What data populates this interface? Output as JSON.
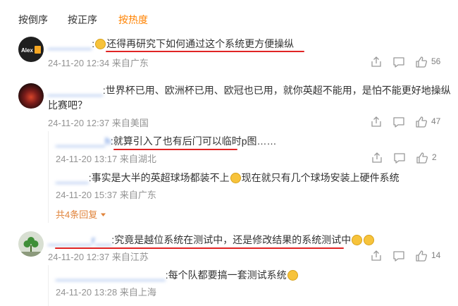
{
  "sort": {
    "reverse": "按倒序",
    "forward": "按正序",
    "hot": "按热度"
  },
  "colors": {
    "accent": "#ff8200",
    "username": "#2e6ad5",
    "underline": "#e02424",
    "meta": "#939393"
  },
  "comments": [
    {
      "avatar_text": "Alex",
      "username": "________",
      "text": "还得再研究下如何通过这个系统更方便操纵",
      "time": "24-11-20 12:34",
      "location": "来自广东",
      "likes": "56"
    },
    {
      "username": "__________",
      "text1": "世界杯已用、欧洲杯已用、欧冠也已用，就你英超不能用，是怕不能更好地操纵",
      "text2": "比赛吧？",
      "time": "24-11-20 12:37",
      "location": "来自美国",
      "likes": "47"
    },
    {
      "username": "________r___",
      "text": "究竟是越位系统在测试中，还是修改结果的系统测试中",
      "time": "24-11-20 12:37",
      "location": "来自江苏",
      "likes": "14"
    }
  ],
  "replies": [
    {
      "username": "_________h",
      "text_a": "就算",
      "text_b": "引入了也有后门可以临时p图……",
      "time": "24-11-20 13:17",
      "location": "来自湖北",
      "likes": "2"
    },
    {
      "username": "______",
      "text_a": "事实是大半的英超球场都装不上",
      "text_b": "现在就只有几个球场安装上硬件系统",
      "time": "24-11-20 15:37",
      "location": "来自广东"
    },
    {
      "username": "____________________",
      "text": "每个队都要搞一套测试系统",
      "time": "24-11-20 13:28",
      "location": "来自上海"
    }
  ],
  "more_replies": "共4条回复",
  "icons": [
    "share-icon",
    "comment-icon",
    "like-icon",
    "chevron-down-icon"
  ]
}
